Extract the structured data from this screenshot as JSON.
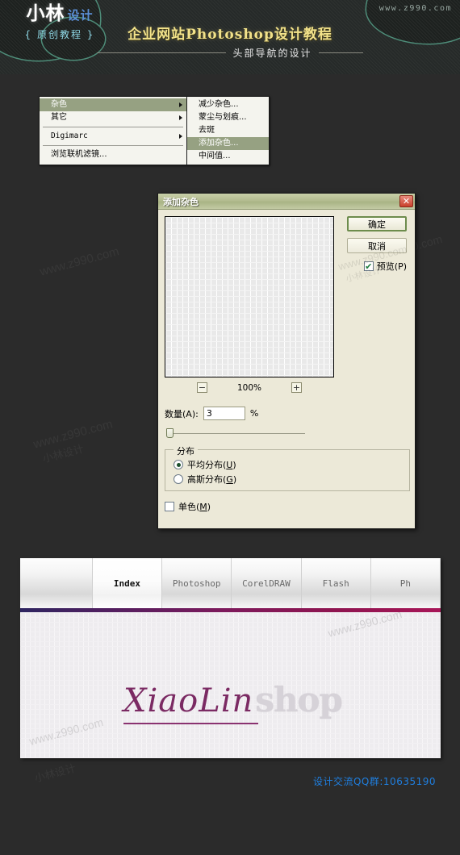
{
  "banner": {
    "logo_main": "小林",
    "logo_sub": "设计",
    "logo_tagline": "{ 原创教程 }",
    "title": "企业网站Photoshop设计教程",
    "subtitle": "头部导航的设计",
    "watermark": "www.z990.com"
  },
  "watermarks": {
    "site": "www.z990.com",
    "author": "小林设计"
  },
  "menu": {
    "left_items": [
      {
        "label": "杂色",
        "selected": true,
        "submenu": true
      },
      {
        "label": "其它",
        "selected": false,
        "submenu": true
      },
      {
        "label": "Digimarc",
        "selected": false,
        "submenu": true,
        "mono": true
      },
      {
        "label": "浏览联机滤镜...",
        "selected": false,
        "submenu": false
      }
    ],
    "right_items": [
      {
        "label": "减少杂色...",
        "selected": false
      },
      {
        "label": "蒙尘与划痕...",
        "selected": false
      },
      {
        "label": "去斑",
        "selected": false
      },
      {
        "label": "添加杂色...",
        "selected": true
      },
      {
        "label": "中间值...",
        "selected": false
      }
    ]
  },
  "dialog": {
    "title": "添加杂色",
    "close_label": "✕",
    "ok_label": "确定",
    "cancel_label": "取消",
    "preview_checkbox": {
      "label": "预览(P)",
      "checked": true,
      "mark": "✔"
    },
    "zoom": {
      "minus": "−",
      "level": "100%",
      "plus": "+"
    },
    "amount": {
      "label": "数量(A):",
      "value": "3",
      "unit": "%"
    },
    "distribution": {
      "group_label": "分布",
      "options": [
        {
          "label_prefix": "平均分布(",
          "key": "U",
          "label_suffix": ")",
          "selected": true
        },
        {
          "label_prefix": "高斯分布(",
          "key": "G",
          "label_suffix": ")",
          "selected": false
        }
      ]
    },
    "monochromatic": {
      "label_prefix": "单色(",
      "key": "M",
      "label_suffix": ")",
      "checked": false,
      "mark": "✔"
    }
  },
  "web_preview": {
    "nav": [
      {
        "label": "",
        "type": "spacer"
      },
      {
        "label": "Index",
        "type": "item",
        "active": true
      },
      {
        "label": "Photoshop",
        "type": "item",
        "active": false
      },
      {
        "label": "CorelDRAW",
        "type": "item",
        "active": false
      },
      {
        "label": "Flash",
        "type": "item",
        "active": false
      },
      {
        "label": "Ph",
        "type": "item",
        "active": false
      }
    ],
    "brand_script": "XiaoLin",
    "brand_bold": "shop"
  },
  "footer": {
    "text": "设计交流QQ群:10635190"
  },
  "colors": {
    "page_bg": "#2b2b2b",
    "banner_title": "#f2e28a",
    "menu_highlight": "#96a182",
    "dialog_titlebar": "#b3bc90",
    "accent_purple": "#7b2a63",
    "footer_blue": "#1f7fe0"
  }
}
